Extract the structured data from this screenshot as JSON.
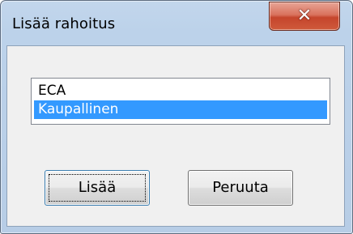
{
  "window": {
    "title": "Lisää rahoitus",
    "close_icon": "close-icon"
  },
  "list": {
    "items": [
      {
        "label": "ECA",
        "selected": false
      },
      {
        "label": "Kaupallinen",
        "selected": true
      }
    ]
  },
  "buttons": {
    "add_label": "Lisää",
    "cancel_label": "Peruuta"
  },
  "colors": {
    "selection": "#3399ff",
    "close_button": "#c5452c",
    "frame": "#bcd2ea"
  }
}
